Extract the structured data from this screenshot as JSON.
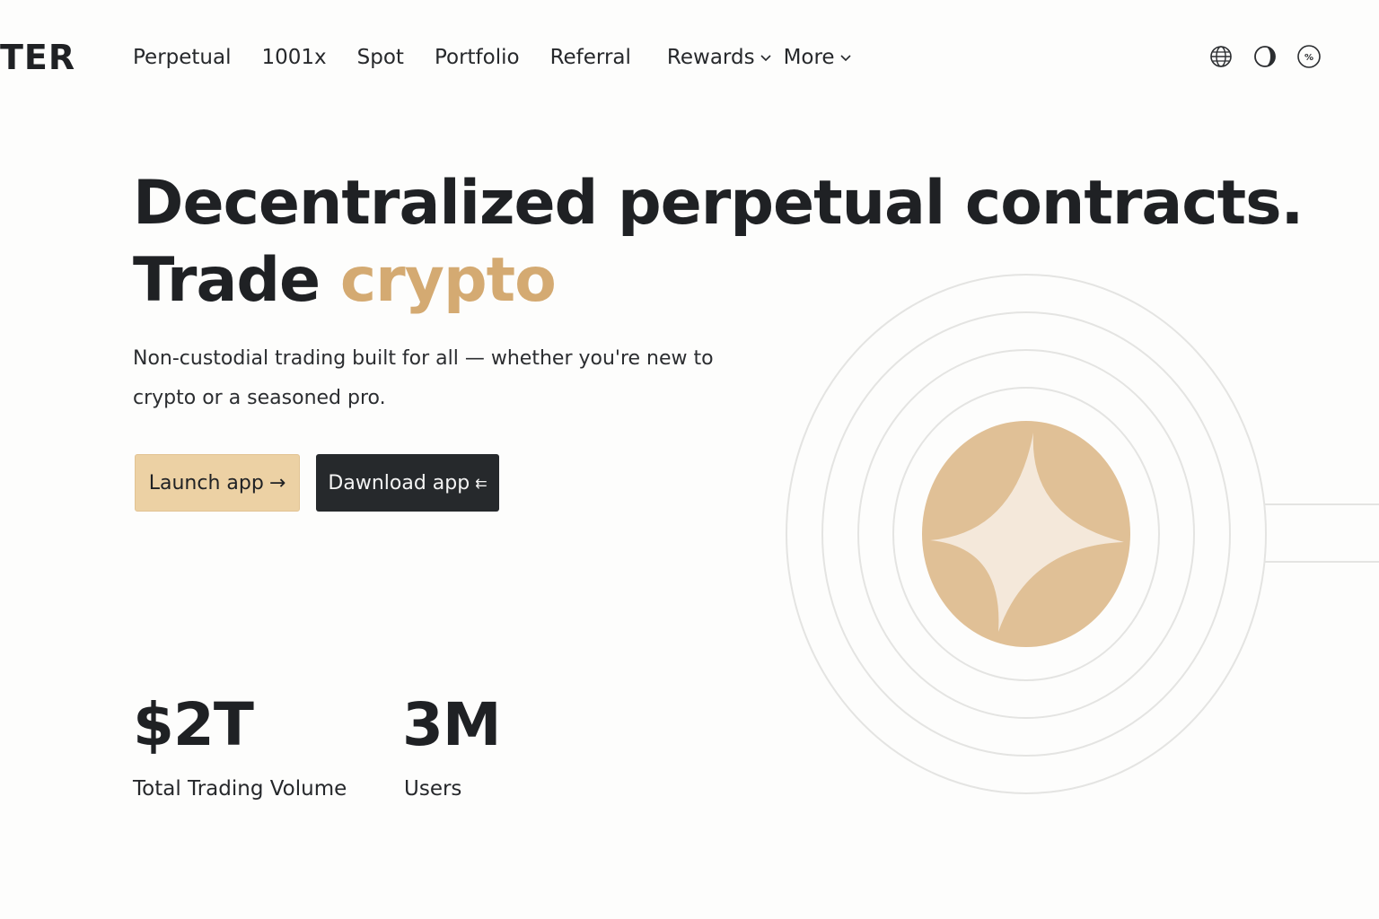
{
  "header": {
    "logo": "TER",
    "nav": [
      {
        "label": "Perpetual"
      },
      {
        "label": "1001x"
      },
      {
        "label": "Spot"
      },
      {
        "label": "Portfolio"
      },
      {
        "label": "Referral"
      },
      {
        "label": "Rewards",
        "dropdown": true
      },
      {
        "label": "More",
        "dropdown": true
      }
    ],
    "icons": [
      "globe-icon",
      "theme-toggle-icon",
      "percent-icon"
    ]
  },
  "hero": {
    "headline_line1": "Decentralized perpetual contracts.",
    "headline_line2_prefix": "Trade ",
    "headline_line2_accent": "crypto",
    "subtitle": "Non-custodial trading built for all — whether you're new to crypto or a seasoned pro.",
    "launch_button": "Launch app",
    "launch_arrow": "→",
    "download_button": "Dawnload app",
    "download_glyph": "⇇"
  },
  "stats": [
    {
      "value": "$2T",
      "label": "Total Trading Volume"
    },
    {
      "value": "3M",
      "label": "Users"
    }
  ],
  "colors": {
    "accent": "#d4aa72",
    "launch_bg": "#ecd1a4",
    "download_bg": "#26292c",
    "coin": "#e0c096",
    "star": "#f4e8da",
    "rings": "#e4e4e2",
    "text": "#1f2124"
  }
}
